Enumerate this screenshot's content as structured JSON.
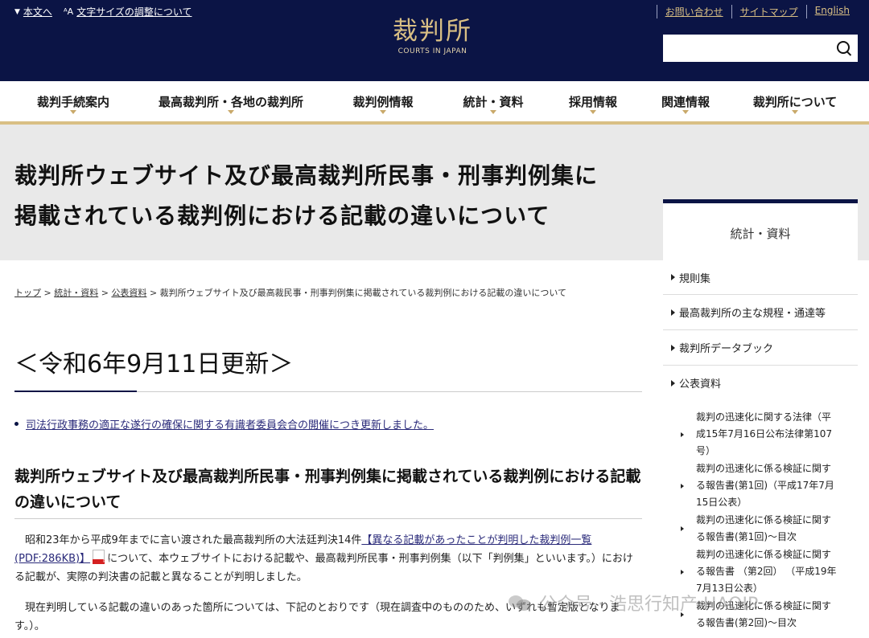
{
  "header": {
    "utility_left": [
      {
        "icon": "triangle-down-icon",
        "icon_glyph": "▼",
        "label": "本文へ"
      },
      {
        "icon": "text-size-icon",
        "icon_glyph": "ᴬA",
        "label": "文字サイズの調整について"
      }
    ],
    "utility_right": [
      "お問い合わせ",
      "サイトマップ",
      "English"
    ],
    "logo_jp": "裁判所",
    "logo_en": "COURTS IN JAPAN",
    "search_placeholder": ""
  },
  "nav": {
    "items": [
      "裁判手続案内",
      "最高裁判所・各地の裁判所",
      "裁判例情報",
      "統計・資料",
      "採用情報",
      "関連情報",
      "裁判所について"
    ]
  },
  "page_title_lines": [
    "裁判所ウェブサイト及び最高裁判所民事・刑事判例集に",
    "掲載されている裁判例における記載の違いについて"
  ],
  "breadcrumb": {
    "links": [
      "トップ",
      "統計・資料",
      "公表資料"
    ],
    "separator": ">",
    "current": "裁判所ウェブサイト及び最高裁民事・刑事判例集に掲載されている裁判例における記載の違いについて"
  },
  "main": {
    "update_heading": "＜令和6年9月11日更新＞",
    "update_item": "司法行政事務の適正な遂行の確保に関する有識者委員会合の開催につき更新しました。",
    "section_heading": "裁判所ウェブサイト及び最高裁判所民事・刑事判例集に掲載されている裁判例における記載の違いについて",
    "para1_before": "昭和23年から平成9年までに言い渡された最高裁判所の大法廷判決14件",
    "para1_link": "【異なる記載があったことが判明した裁判例一覧(PDF:286KB)】",
    "para1_after": "について、本ウェブサイトにおける記載や、最高裁判所民事・刑事判例集（以下「判例集」といいます。）における記載が、実際の判決書の記載と異なることが判明しました。",
    "para2": "現在判明している記載の違いのあった箇所については、下記のとおりです（現在調査中のもののため、いずれも暫定版となります。）。"
  },
  "sidebar": {
    "heading": "統計・資料",
    "items": [
      "規則集",
      "最高裁判所の主な規程・通達等",
      "裁判所データブック",
      "公表資料"
    ],
    "subitems": [
      [
        "裁判の迅速化に関する法律（平",
        "成15年7月16日公布法律第107",
        "号）"
      ],
      [
        "裁判の迅速化に係る検証に関す",
        "る報告書(第1回)（平成17年7月",
        "15日公表）"
      ],
      [
        "裁判の迅速化に係る検証に関す",
        "る報告書(第1回)～目次"
      ],
      [
        "裁判の迅速化に係る検証に関す",
        "る報告書 （第2回）  （平成19年",
        "7月13日公表）"
      ],
      [
        "裁判の迅速化に係る検証に関す",
        "る報告書(第2回)～目次"
      ]
    ]
  },
  "watermark": "公众号 · 浩思行知产 HAOIP",
  "colors": {
    "navy": "#0b1445",
    "gold": "#d9bf84",
    "band": "#e9e9e9"
  }
}
